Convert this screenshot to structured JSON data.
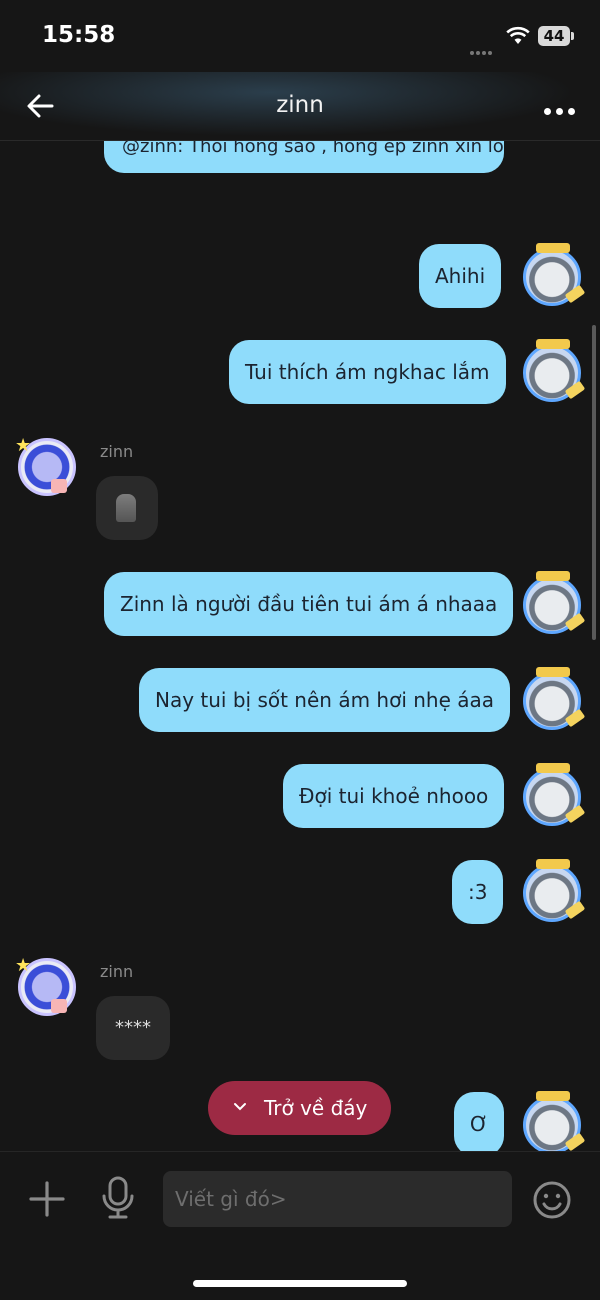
{
  "status_bar": {
    "time": "15:58",
    "battery": "44"
  },
  "header": {
    "title": "zinn"
  },
  "messages": {
    "reply_preview": "@zinn: Thôi hông sao , hông ép zinn xin lỗi",
    "out_1": "Ahihi",
    "out_2": "Tui thích ám ngkhac lắm",
    "in_1_sender": "zinn",
    "out_3": "Zinn là người đầu tiên tui ám á nhaaa",
    "out_4": "Nay tui bị sốt nên ám hơi nhẹ áaa",
    "out_5": "Đợi tui khoẻ nhooo",
    "out_6": ":3",
    "in_2_sender": "zinn",
    "in_2_text": "****",
    "out_7": "Ơ"
  },
  "back_to_bottom": {
    "label": "Trở về đáy"
  },
  "composer": {
    "placeholder": "Viết gì đó>"
  },
  "colors": {
    "outgoing_bubble": "#8fdcfb",
    "incoming_bubble": "#2a2a2a",
    "back_button": "#9d2a44",
    "background": "#161616"
  },
  "icons": {
    "back": "arrow-left-icon",
    "more": "more-dots-icon",
    "plus": "plus-icon",
    "mic": "microphone-icon",
    "emoji": "smiley-icon"
  }
}
